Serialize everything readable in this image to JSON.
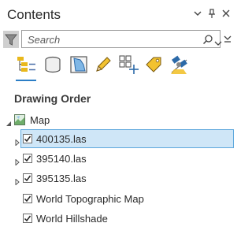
{
  "pane": {
    "title": "Contents"
  },
  "search": {
    "placeholder": "Search"
  },
  "toolbar": {
    "tools": [
      "list-by-drawing-order-icon",
      "list-by-data-source-icon",
      "list-by-selection-icon",
      "list-by-editing-icon",
      "list-by-snapping-icon",
      "list-by-labeling-icon",
      "list-by-perspective-imagery-icon"
    ],
    "selected": "list-by-drawing-order-icon"
  },
  "section": {
    "title": "Drawing Order"
  },
  "tree": {
    "map_label": "Map",
    "layers": [
      {
        "label": "400135.las",
        "checked": true,
        "selected": true,
        "expandable": true
      },
      {
        "label": "395140.las",
        "checked": true,
        "selected": false,
        "expandable": true
      },
      {
        "label": "395135.las",
        "checked": true,
        "selected": false,
        "expandable": true
      },
      {
        "label": "World Topographic Map",
        "checked": true,
        "selected": false,
        "expandable": false
      },
      {
        "label": "World Hillshade",
        "checked": true,
        "selected": false,
        "expandable": false
      }
    ]
  },
  "colors": {
    "accent": "#2c7ec6",
    "selection_fill": "#cfe6f7",
    "selection_border": "#5ea8dd"
  }
}
